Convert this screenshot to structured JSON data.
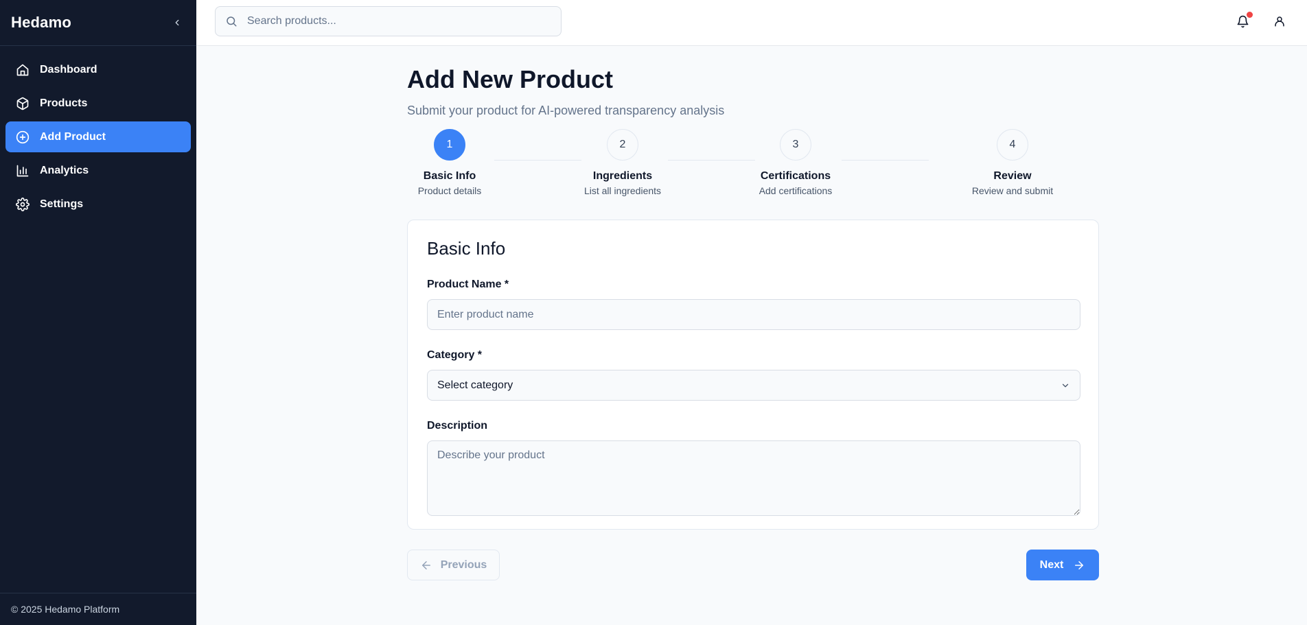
{
  "sidebar": {
    "brand": "Hedamo",
    "items": [
      {
        "label": "Dashboard",
        "icon": "home-icon"
      },
      {
        "label": "Products",
        "icon": "box-icon"
      },
      {
        "label": "Add Product",
        "icon": "plus-circle-icon",
        "active": true
      },
      {
        "label": "Analytics",
        "icon": "bar-chart-icon"
      },
      {
        "label": "Settings",
        "icon": "gear-icon"
      }
    ],
    "footer": "© 2025 Hedamo Platform"
  },
  "topbar": {
    "search_placeholder": "Search products...",
    "has_notification": true
  },
  "page": {
    "title": "Add New Product",
    "subtitle": "Submit your product for AI-powered transparency analysis"
  },
  "stepper": {
    "steps": [
      {
        "number": "1",
        "title": "Basic Info",
        "subtitle": "Product details",
        "active": true
      },
      {
        "number": "2",
        "title": "Ingredients",
        "subtitle": "List all ingredients",
        "active": false
      },
      {
        "number": "3",
        "title": "Certifications",
        "subtitle": "Add certifications",
        "active": false
      },
      {
        "number": "4",
        "title": "Review",
        "subtitle": "Review and submit",
        "active": false
      }
    ]
  },
  "form": {
    "title": "Basic Info",
    "product_name_label": "Product Name *",
    "product_name_placeholder": "Enter product name",
    "product_name_value": "",
    "category_label": "Category *",
    "category_value": "Select category",
    "description_label": "Description",
    "description_placeholder": "Describe your product",
    "description_value": ""
  },
  "actions": {
    "previous_label": "Previous",
    "next_label": "Next"
  },
  "colors": {
    "sidebar_bg": "#121a2c",
    "accent": "#3b82f6",
    "notification": "#ef4444",
    "page_bg": "#f8fafc"
  }
}
